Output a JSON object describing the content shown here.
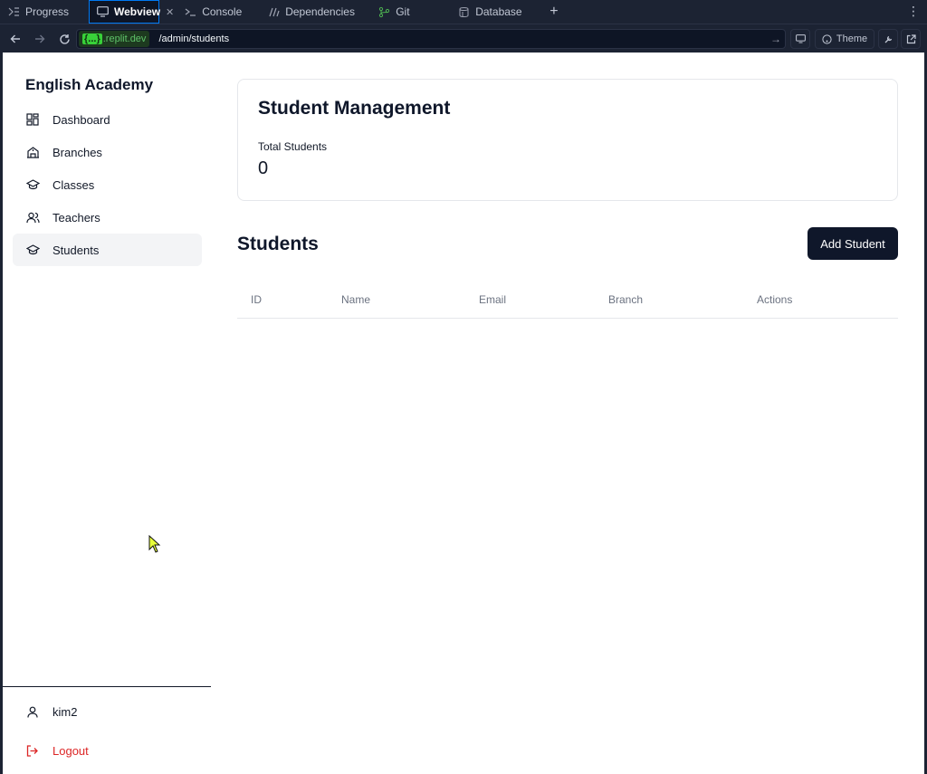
{
  "ide": {
    "tabs": [
      {
        "label": "Progress",
        "icon": "progress-icon"
      },
      {
        "label": "Webview",
        "icon": "monitor-icon",
        "active": true
      },
      {
        "label": "Console",
        "icon": "terminal-icon"
      },
      {
        "label": "Dependencies",
        "icon": "dependencies-icon"
      },
      {
        "label": "Git",
        "icon": "git-icon"
      },
      {
        "label": "Database",
        "icon": "database-icon"
      }
    ],
    "add_tab": "+",
    "more": "⋮",
    "url": {
      "domain_badge": "{...}",
      "domain": ".replit.dev",
      "path": "/admin/students"
    },
    "theme_label": "Theme"
  },
  "app": {
    "brand": "English Academy",
    "nav": [
      {
        "label": "Dashboard",
        "icon": "dashboard-icon"
      },
      {
        "label": "Branches",
        "icon": "school-icon"
      },
      {
        "label": "Classes",
        "icon": "graduation-cap-icon"
      },
      {
        "label": "Teachers",
        "icon": "users-icon"
      },
      {
        "label": "Students",
        "icon": "graduation-cap-icon",
        "active": true
      }
    ],
    "user": {
      "name": "kim2"
    },
    "logout_label": "Logout",
    "card": {
      "title": "Student Management",
      "stat_label": "Total Students",
      "stat_value": "0"
    },
    "section_title": "Students",
    "add_button": "Add Student",
    "table": {
      "columns": [
        "ID",
        "Name",
        "Email",
        "Branch",
        "Actions"
      ],
      "rows": []
    }
  },
  "colors": {
    "accent": "#0f172a",
    "logout": "#dc2626",
    "ide_bg": "#1c2333",
    "active_tab_border": "#0079f2"
  }
}
